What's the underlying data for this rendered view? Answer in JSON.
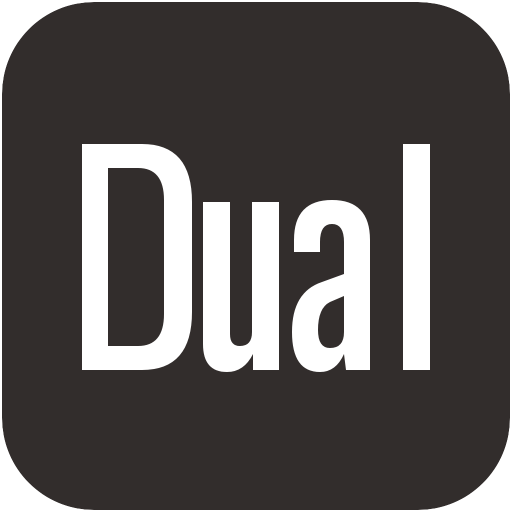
{
  "icon": {
    "background_color": "#322d2c",
    "logo_color": "#ffffff",
    "logo_text": "Dual"
  }
}
